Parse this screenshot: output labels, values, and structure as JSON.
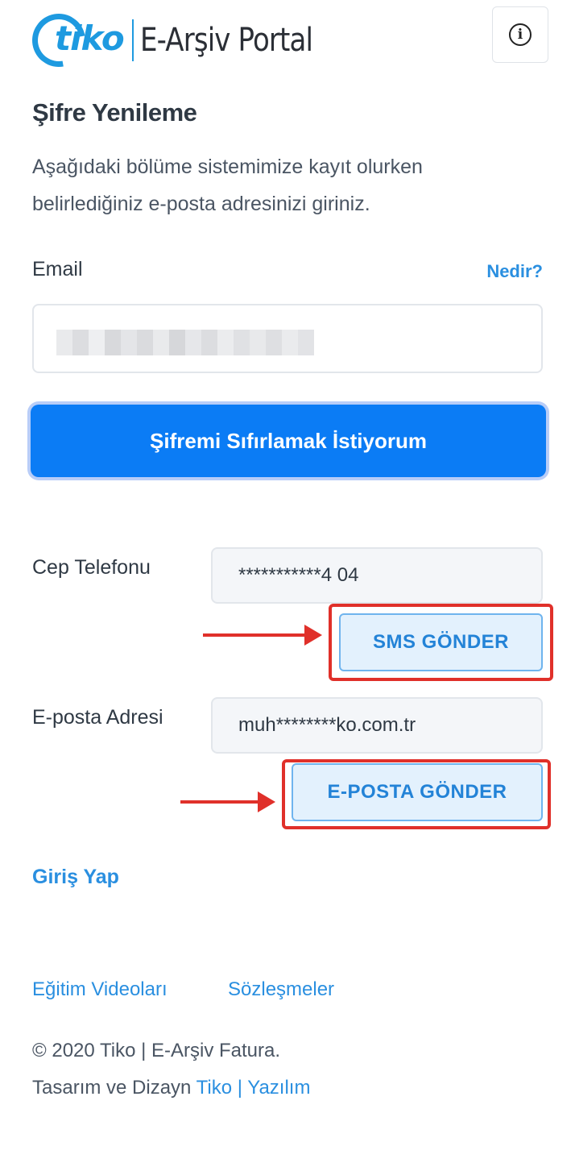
{
  "header": {
    "logo_word": "tiko",
    "portal_name": "E-Arşiv Portal"
  },
  "page": {
    "title": "Şifre Yenileme",
    "description": "Aşağıdaki bölüme sistemimize kayıt olurken belirlediğiniz e-posta adresinizi giriniz."
  },
  "email_section": {
    "label": "Email",
    "help_link": "Nedir?",
    "value": ""
  },
  "reset_button": "Şifremi Sıfırlamak İstiyorum",
  "verification": {
    "phone": {
      "label": "Cep Telefonu",
      "masked_value": "***********4 04",
      "button": "SMS GÖNDER"
    },
    "email": {
      "label": "E-posta Adresi",
      "masked_value": "muh********ko.com.tr",
      "button": "E-POSTA GÖNDER"
    }
  },
  "login_link": "Giriş Yap",
  "footer": {
    "links": [
      "Eğitim Videoları",
      "Sözleşmeler"
    ],
    "copyright": "© 2020 Tiko | E-Arşiv Fatura.",
    "design_prefix": "Tasarım ve Dizayn",
    "design_brand": "Tiko | Yazılım"
  },
  "colors": {
    "primary": "#0b7cf5",
    "link": "#2a8fe0",
    "highlight": "#e0302a"
  }
}
